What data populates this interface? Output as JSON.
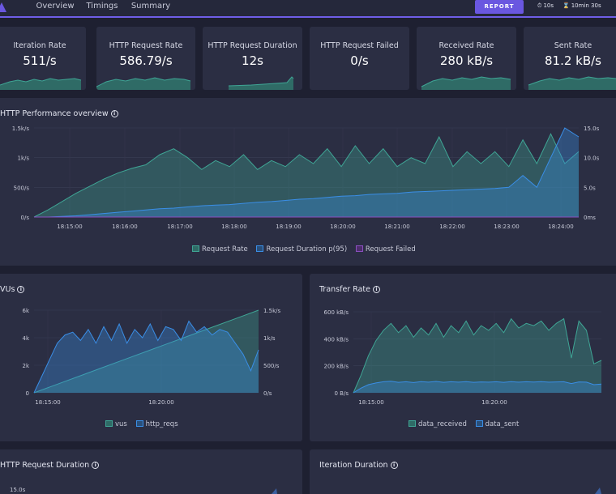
{
  "header": {
    "tabs": [
      {
        "label": "Overview",
        "active": true
      },
      {
        "label": "Timings",
        "active": false
      },
      {
        "label": "Summary",
        "active": false
      }
    ],
    "report_label": "REPORT",
    "period": "10s",
    "duration": "10min 30s"
  },
  "colors": {
    "accent": "#6a57e0",
    "teal": "#3fa595",
    "blue": "#3a8ee6",
    "purple": "#8a4fbf"
  },
  "stats": [
    {
      "title": "Iteration Rate",
      "value": "511/s"
    },
    {
      "title": "HTTP Request Rate",
      "value": "586.79/s"
    },
    {
      "title": "HTTP Request Duration",
      "value": "12s"
    },
    {
      "title": "HTTP Request Failed",
      "value": "0/s"
    },
    {
      "title": "Received Rate",
      "value": "280 kB/s"
    },
    {
      "title": "Sent Rate",
      "value": "81.2 kB/s"
    }
  ],
  "panels": {
    "performance": {
      "title": "HTTP Performance overview",
      "legend": [
        "Request Rate",
        "Request Duration p(95)",
        "Request Failed"
      ]
    },
    "vus": {
      "title": "VUs",
      "legend": [
        "vus",
        "http_reqs"
      ]
    },
    "transfer": {
      "title": "Transfer Rate",
      "legend": [
        "data_received",
        "data_sent"
      ]
    },
    "http_duration": {
      "title": "HTTP Request Duration",
      "ytick": "15.0s"
    },
    "iteration_duration": {
      "title": "Iteration Duration"
    }
  },
  "chart_data": [
    {
      "type": "area",
      "title": "HTTP Performance overview",
      "x": [
        "18:14:30",
        "18:14:45",
        "18:15:00",
        "18:15:15",
        "18:15:30",
        "18:15:45",
        "18:16:00",
        "18:16:15",
        "18:16:30",
        "18:16:45",
        "18:17:00",
        "18:17:15",
        "18:17:30",
        "18:17:45",
        "18:18:00",
        "18:18:15",
        "18:18:30",
        "18:18:45",
        "18:19:00",
        "18:19:15",
        "18:19:30",
        "18:19:45",
        "18:20:00",
        "18:20:15",
        "18:20:30",
        "18:20:45",
        "18:21:00",
        "18:21:15",
        "18:21:30",
        "18:21:45",
        "18:22:00",
        "18:22:15",
        "18:22:30",
        "18:22:45",
        "18:23:00",
        "18:23:15",
        "18:23:30",
        "18:23:45",
        "18:24:00",
        "18:24:15"
      ],
      "x_ticks": [
        "18:15:00",
        "18:16:00",
        "18:17:00",
        "18:18:00",
        "18:19:00",
        "18:20:00",
        "18:21:00",
        "18:22:00",
        "18:23:00",
        "18:24:00"
      ],
      "series": [
        {
          "name": "Request Rate",
          "axis": "left",
          "values": [
            0,
            120,
            260,
            400,
            520,
            640,
            740,
            820,
            880,
            1050,
            1150,
            1000,
            800,
            950,
            850,
            1050,
            800,
            950,
            850,
            1050,
            900,
            1150,
            850,
            1200,
            900,
            1150,
            850,
            1000,
            900,
            1350,
            850,
            1100,
            900,
            1100,
            850,
            1300,
            900,
            1400,
            900,
            1100
          ]
        },
        {
          "name": "Request Duration p(95)",
          "axis": "right",
          "values": [
            0,
            0,
            0.1,
            0.2,
            0.4,
            0.6,
            0.8,
            1.0,
            1.2,
            1.4,
            1.5,
            1.7,
            1.9,
            2.0,
            2.1,
            2.3,
            2.5,
            2.6,
            2.8,
            3.0,
            3.1,
            3.3,
            3.5,
            3.6,
            3.8,
            3.9,
            4.0,
            4.2,
            4.3,
            4.4,
            4.5,
            4.6,
            4.7,
            4.8,
            5.0,
            7.0,
            5.0,
            10.0,
            15.0,
            13.5
          ]
        },
        {
          "name": "Request Failed",
          "axis": "left",
          "values": [
            0,
            0,
            0,
            0,
            0,
            0,
            0,
            0,
            0,
            0,
            0,
            0,
            0,
            0,
            0,
            0,
            0,
            0,
            0,
            0,
            0,
            0,
            0,
            0,
            0,
            0,
            0,
            0,
            0,
            0,
            0,
            0,
            0,
            0,
            0,
            0,
            0,
            0,
            0,
            0
          ]
        }
      ],
      "y_left": {
        "ticks": [
          "0/s",
          "500/s",
          "1k/s",
          "1.5k/s"
        ],
        "range": [
          0,
          1500
        ]
      },
      "y_right": {
        "ticks": [
          "0ms",
          "5.0s",
          "10.0s",
          "15.0s"
        ],
        "range": [
          0,
          15
        ]
      }
    },
    {
      "type": "area",
      "title": "VUs",
      "x_ticks": [
        "18:15:00",
        "18:20:00"
      ],
      "series": [
        {
          "name": "vus",
          "axis": "left",
          "values": [
            0,
            600,
            1200,
            1800,
            2400,
            3000,
            3600,
            4200,
            4800,
            5400,
            6000
          ]
        },
        {
          "name": "http_reqs",
          "axis": "right",
          "values": [
            0,
            300,
            600,
            900,
            1050,
            1100,
            950,
            1150,
            900,
            1200,
            950,
            1250,
            900,
            1150,
            1000,
            1250,
            950,
            1200,
            1150,
            950,
            1300,
            1100,
            1200,
            1050,
            1150,
            1100,
            900,
            700,
            400,
            780
          ]
        }
      ],
      "y_left": {
        "ticks": [
          "0",
          "2k",
          "4k",
          "6k"
        ],
        "range": [
          0,
          6000
        ]
      },
      "y_right": {
        "ticks": [
          "0/s",
          "500/s",
          "1k/s",
          "1.5k/s"
        ],
        "range": [
          0,
          1500
        ]
      }
    },
    {
      "type": "area",
      "title": "Transfer Rate",
      "x_ticks": [
        "18:15:00",
        "18:20:00"
      ],
      "series": [
        {
          "name": "data_received",
          "values": [
            0,
            150,
            320,
            450,
            540,
            600,
            520,
            580,
            480,
            560,
            500,
            600,
            480,
            580,
            520,
            620,
            500,
            580,
            540,
            600,
            520,
            640,
            560,
            600,
            580,
            620,
            540,
            600,
            640,
            300,
            620,
            540,
            250,
            280
          ]
        },
        {
          "name": "data_sent",
          "values": [
            0,
            40,
            70,
            85,
            95,
            100,
            90,
            95,
            88,
            96,
            92,
            98,
            90,
            95,
            92,
            96,
            90,
            94,
            92,
            95,
            90,
            96,
            92,
            95,
            93,
            96,
            92,
            94,
            95,
            80,
            94,
            92,
            70,
            75
          ]
        }
      ],
      "y_left": {
        "ticks": [
          "0 B/s",
          "200 kB/s",
          "400 kB/s",
          "600 kB/s"
        ],
        "range": [
          0,
          700
        ]
      }
    }
  ]
}
